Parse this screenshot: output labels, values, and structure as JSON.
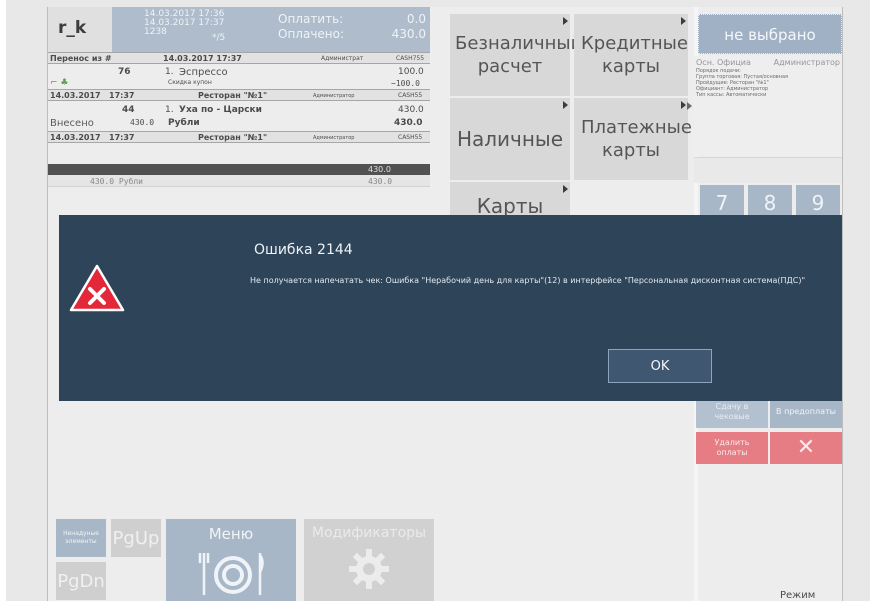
{
  "header": {
    "logo": "r_k",
    "time_1": "14.03.2017 17:36",
    "time_2": "14.03.2017 17:37",
    "time_3": "1238",
    "guests": "*/5",
    "to_pay_label": "Оплатить:",
    "to_pay_value": "0.0",
    "paid_label": "Оплачено:",
    "paid_value": "430.0"
  },
  "check": {
    "transfer_header": {
      "label": "Перенос из #",
      "date": "14.03.2017 17:37",
      "role": "Администрат",
      "cash": "CASH755"
    },
    "item1": {
      "code": "76",
      "qty": "1.",
      "name": "Эспрессо",
      "price": "100.0"
    },
    "discount": {
      "label": "Скидка купон",
      "value": "−100.0"
    },
    "sub1": {
      "date": "14.03.2017",
      "time": "17:37",
      "place": "Ресторан \"№1\"",
      "role": "Администратор",
      "cash": "CASH55"
    },
    "item2": {
      "code": "44",
      "qty": "1.",
      "name": "Уха по - Царски",
      "price": "430.0"
    },
    "deposit": {
      "label": "Внесено",
      "amount": "430.0",
      "currency": "Рубли",
      "value": "430.0"
    },
    "sub2": {
      "date": "14.03.2017",
      "time": "17:37",
      "place": "Ресторан \"№1\"",
      "role": "Администратор",
      "cash": "CASH55"
    },
    "dark_value": "430.0",
    "total": {
      "left": "430.0 Рубли",
      "right": "430.0"
    }
  },
  "payments": {
    "cashless": "Безналичный расчет",
    "credit": "Кредитные карты",
    "cash": "Наличные",
    "payment_cards": "Платежные карты",
    "cards": "Карты"
  },
  "right": {
    "not_selected": "не выбрано",
    "officiant_label": "Осн. Официа",
    "officiant_role": "Администратор",
    "info_lines": [
      "Порядок подачи:",
      "Группа торговая: Пустая/основная",
      "Пройдущие: Ресторан \"№1\"",
      "Официант: Администратор",
      "Тип кассы: Автоматически"
    ],
    "keys": [
      "7",
      "8",
      "9"
    ],
    "split": "Сдачу в чековые",
    "prepay": "В предоплаты",
    "delete": "Удалить оплаты",
    "close": "✕",
    "payment_mode": "Режим оплаты"
  },
  "bottom": {
    "unnecessary": "Ненадуные элементы",
    "pgup": "PgUp",
    "pgdn": "PgDn",
    "menu": "Меню",
    "modifiers": "Модификаторы"
  },
  "dialog": {
    "title": "Ошибка 2144",
    "message": "Не получается напечатать чек: Ошибка \"Нерабочий день для карты\"(12) в интерфейсе \"Персональная дисконтная система(ПДС)\"",
    "ok": "OK"
  },
  "colors": {
    "dialog_bg": "#2e4459",
    "accent_blue": "#93a7bd",
    "delete_red": "#e36a73",
    "warning_red": "#e3283a"
  }
}
